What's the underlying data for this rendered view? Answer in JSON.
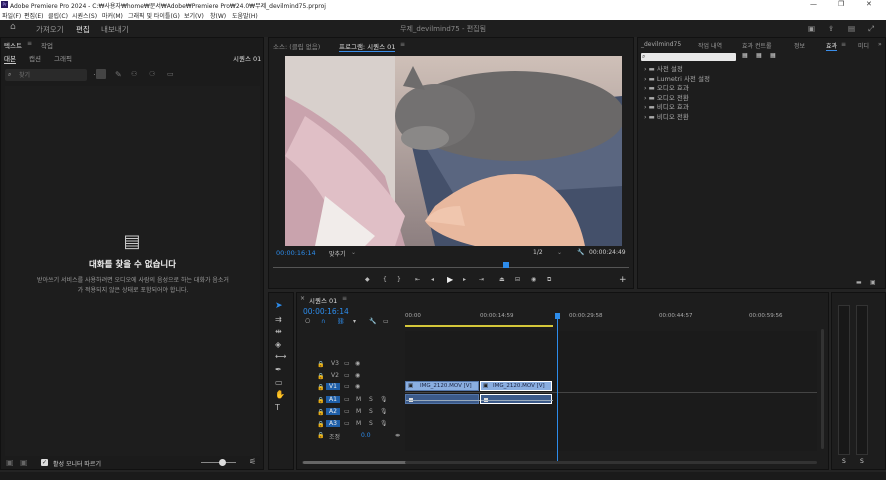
{
  "titlebar": {
    "logo": "Pr",
    "title": "Adobe Premiere Pro 2024 - C:₩사용자₩home₩문서₩Adobe₩Premiere Pro₩24.0₩무제_devilmind75.prproj",
    "controls": [
      "—",
      "❐",
      "✕"
    ]
  },
  "menu": [
    "파일(F)",
    "편집(E)",
    "클립(C)",
    "시퀀스(S)",
    "마커(M)",
    "그래픽 및 타이틀(G)",
    "보기(V)",
    "창(W)",
    "도움말(H)"
  ],
  "workspace": {
    "tabs": [
      "가져오기",
      "편집",
      "내보내기"
    ],
    "active": "편집",
    "project_title": "무제_devilmind75 - 편집됨"
  },
  "text_panel": {
    "tabs": [
      "텍스트",
      "작업"
    ],
    "subtabs": [
      "대본",
      "캡션",
      "그래픽"
    ],
    "sequence": "시퀀스 01",
    "search_placeholder": "찾기",
    "empty_title": "대화를 찾을 수 없습니다",
    "empty_body": "받아쓰기 서비스를 사용하려면 오디오에 사람의 음성으로 하는 대화가 음소거가 적용되지 않은 상태로 포함되어야 합니다.",
    "footer_checkbox": "활성 모니터 따르기"
  },
  "source_panel": {
    "tab_source": "소스: (클립 없음)",
    "tab_program": "프로그램: 시퀀스 01",
    "timecode": "00:00:16:14",
    "fit": "맞추기",
    "ratio": "1/2",
    "duration": "00:00:24:49"
  },
  "effects_panel": {
    "tabs": [
      "_devilmind75",
      "작업 내역",
      "효과 컨트롤",
      "정보",
      "효과",
      "미디"
    ],
    "active": "효과",
    "items": [
      "사전 설정",
      "Lumetri 사전 설정",
      "오디오 효과",
      "오디오 전환",
      "비디오 효과",
      "비디오 전환"
    ]
  },
  "timeline": {
    "tab": "시퀀스 01",
    "timecode": "00:00:16:14",
    "ruler": [
      "00:00",
      "00:00:14:59",
      "00:00:29:58",
      "00:00:44:57",
      "00:00:59:56"
    ],
    "video_tracks": [
      "V3",
      "V2",
      "V1"
    ],
    "audio_tracks": [
      "A1",
      "A2",
      "A3"
    ],
    "master_label": "조정",
    "master_value": "0.0",
    "clip1": "IMG_2120.MOV [V]",
    "clip2": "IMG_2120.MOV [V]",
    "playhead_fraction": 0.37
  },
  "audio_meter": {
    "labels": [
      "S",
      "S"
    ]
  }
}
